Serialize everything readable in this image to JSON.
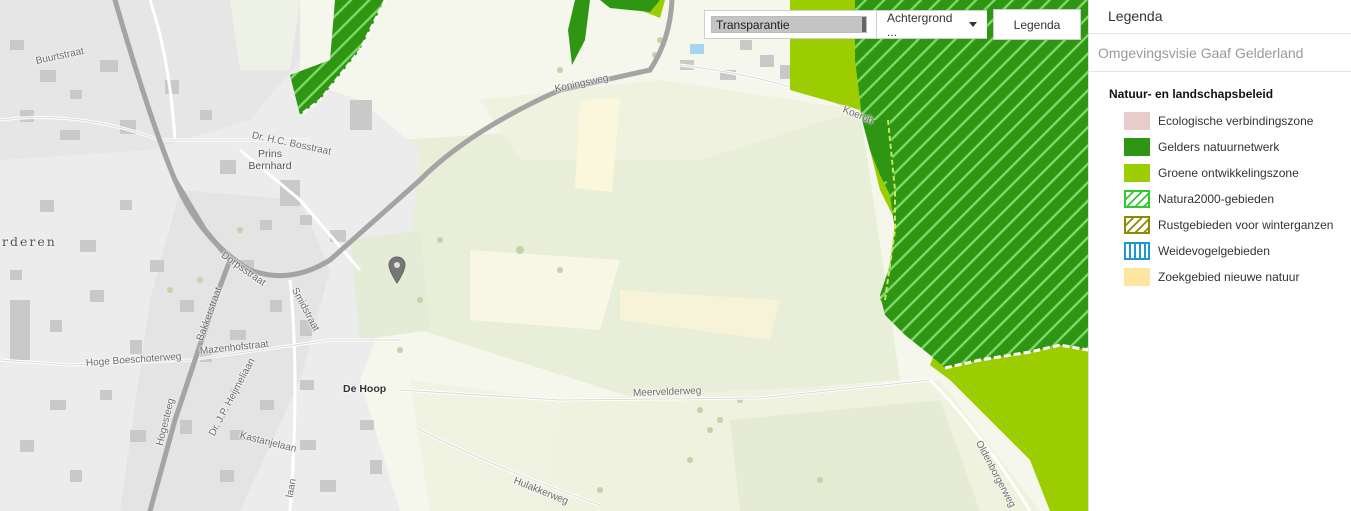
{
  "toolbar": {
    "transparency_label": "Transparantie",
    "transparency_value": 0.99,
    "background_label": "Achtergrond ...",
    "legend_button": "Legenda"
  },
  "panel": {
    "title": "Legenda",
    "subtitle": "Omgevingsvisie Gaaf Gelderland",
    "group_title": "Natuur- en landschapsbeleid",
    "items": [
      {
        "label": "Ecologische verbindingszone",
        "swatch": "solid",
        "color": "#e8cccc"
      },
      {
        "label": "Gelders natuurnetwerk",
        "swatch": "solid",
        "color": "#2e9612"
      },
      {
        "label": "Groene ontwikkelingszone",
        "swatch": "solid",
        "color": "#9ccd00"
      },
      {
        "label": "Natura2000-gebieden",
        "swatch": "diag-green",
        "color": "#32c832"
      },
      {
        "label": "Rustgebieden voor winterganzen",
        "swatch": "diag-olive",
        "color": "#8c8a00"
      },
      {
        "label": "Weidevogelgebieden",
        "swatch": "vert-blue",
        "color": "#1e96d2"
      },
      {
        "label": "Zoekgebied nieuwe natuur",
        "swatch": "solid",
        "color": "#ffe6a0"
      }
    ]
  },
  "map": {
    "places": [
      "Prins Bernhard",
      "De Hoop"
    ],
    "town": "rderen",
    "streets": [
      "Buurtstraat",
      "Koningsweg",
      "Dr. H.C. Bosstraat",
      "Dorpsstraat",
      "Smidstraat",
      "Bakkerstraat",
      "Hoge Boeschoterweg",
      "Mazenhofstraat",
      "Meervelderweg",
      "Hogesteeg",
      "Dr. J.P. Heijmeliaan",
      "Kastanjelaan",
      "Hulakkerweg",
      "Oldenborgerweg",
      "Koeroh",
      "Heijmeliaan",
      "laan"
    ]
  }
}
